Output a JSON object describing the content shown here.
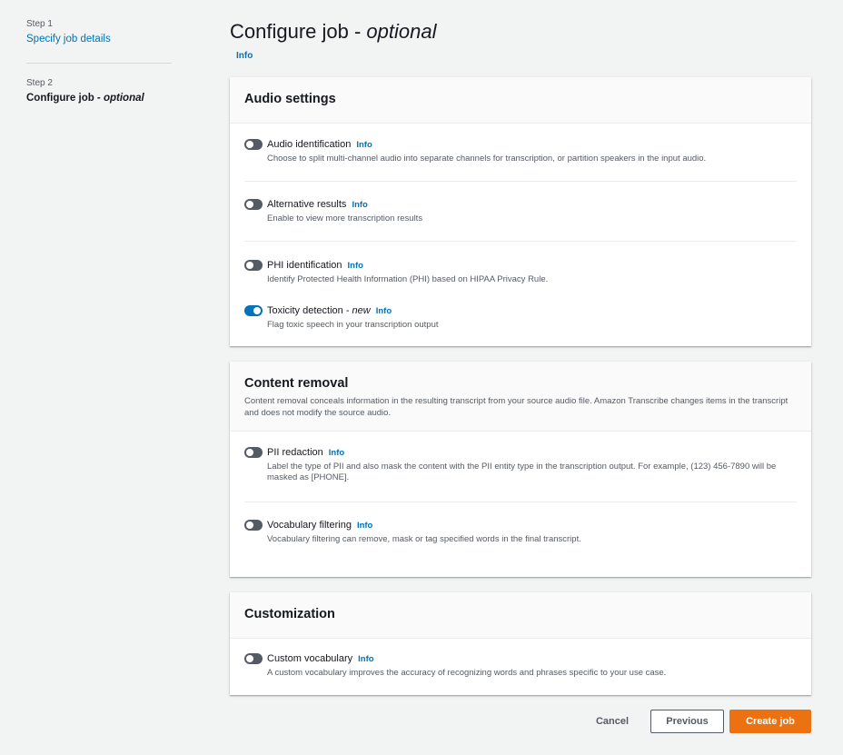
{
  "sidebar": {
    "steps": [
      {
        "label": "Step 1",
        "title": "Specify job details"
      },
      {
        "label": "Step 2",
        "title": "Configure job - ",
        "title_emph": "optional"
      }
    ]
  },
  "header": {
    "title": "Configure job - ",
    "title_emph": "optional",
    "info": "Info"
  },
  "audio_settings": {
    "title": "Audio settings",
    "items": [
      {
        "label": "Audio identification",
        "info": "Info",
        "desc": "Choose to split multi-channel audio into separate channels for transcription, or partition speakers in the input audio.",
        "enabled": false
      },
      {
        "label": "Alternative results",
        "info": "Info",
        "desc": "Enable to view more transcription results",
        "enabled": false
      },
      {
        "label": "PHI identification",
        "info": "Info",
        "desc": "Identify Protected Health Information (PHI) based on HIPAA Privacy Rule.",
        "enabled": false
      },
      {
        "label": "Toxicity detection - ",
        "label_emph": "new",
        "info": "Info",
        "desc": "Flag toxic speech in your transcription output",
        "enabled": true
      }
    ]
  },
  "content_removal": {
    "title": "Content removal",
    "desc": "Content removal conceals information in the resulting transcript from your source audio file. Amazon Transcribe changes items in the transcript and does not modify the source audio.",
    "items": [
      {
        "label": "PII redaction",
        "info": "Info",
        "desc": "Label the type of PII and also mask the content with the PII entity type in the transcription output. For example, (123) 456-7890 will be masked as [PHONE].",
        "enabled": false
      },
      {
        "label": "Vocabulary filtering",
        "info": "Info",
        "desc": "Vocabulary filtering can remove, mask or tag specified words in the final transcript.",
        "enabled": false
      }
    ]
  },
  "customization": {
    "title": "Customization",
    "items": [
      {
        "label": "Custom vocabulary",
        "info": "Info",
        "desc": "A custom vocabulary improves the accuracy of recognizing words and phrases specific to your use case.",
        "enabled": false
      }
    ]
  },
  "footer": {
    "cancel": "Cancel",
    "previous": "Previous",
    "create": "Create job"
  },
  "colors": {
    "accent": "#0073bb",
    "primary_button": "#ec7211",
    "toggle_off": "#545b64"
  }
}
